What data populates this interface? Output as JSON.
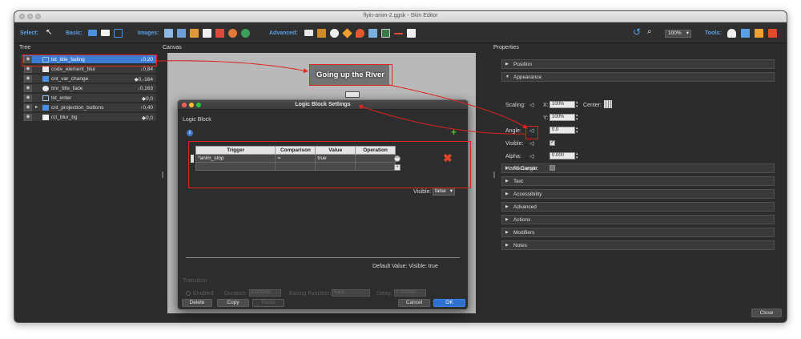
{
  "window": {
    "title": "flyin-anim-2.ggsk - Skin Editor"
  },
  "toolbar": {
    "select_label": "Select:",
    "basic_label": "Basic:",
    "images_label": "Images:",
    "advanced_label": "Advanced:",
    "zoom_value": "100%",
    "tools_label": "Tools:"
  },
  "panels": {
    "tree_label": "Tree",
    "canvas_label": "Canvas",
    "properties_label": "Properties"
  },
  "tree": {
    "items": [
      {
        "name": "txt_title_fading",
        "value": "↓0,20",
        "icon": "text-icon",
        "selected": true
      },
      {
        "name": "code_element_blur",
        "value": "↓0,84",
        "icon": "code-icon",
        "selected": false
      },
      {
        "name": "cnt_var_change",
        "value": "◆0,-164",
        "icon": "folder-icon",
        "selected": false
      },
      {
        "name": "tmr_title_fade",
        "value": "↓0,163",
        "icon": "timer-icon",
        "selected": false
      },
      {
        "name": "txt_enter",
        "value": "◆0,0",
        "icon": "text-icon",
        "selected": false
      },
      {
        "name": "cnt_projection_buttons",
        "value": "↑0,40",
        "icon": "folder-icon",
        "selected": false
      },
      {
        "name": "rct_blur_bg",
        "value": "◆0,0",
        "icon": "rectangle-icon",
        "selected": false
      }
    ]
  },
  "canvas": {
    "title_text": "Going up the River"
  },
  "properties": {
    "sections": [
      {
        "label": "Position",
        "expanded": false
      },
      {
        "label": "Appearance",
        "expanded": true
      },
      {
        "label": "Rectangle",
        "expanded": false
      },
      {
        "label": "Text",
        "expanded": false
      },
      {
        "label": "Accessibility",
        "expanded": false
      },
      {
        "label": "Advanced",
        "expanded": false
      },
      {
        "label": "Actions",
        "expanded": false
      },
      {
        "label": "Modifiers",
        "expanded": false
      },
      {
        "label": "Notes",
        "expanded": false
      }
    ],
    "scaling_label": "Scaling:",
    "x_label": "X:",
    "scale_x": "100%",
    "center_label": "Center:",
    "y_label": "Y:",
    "scale_y": "100%",
    "angle_label": "Angle:",
    "angle_value": "0.0",
    "visible_label": "Visible:",
    "alpha_label": "Alpha:",
    "alpha_value": "0.000",
    "hand_cursor_label": "Hand Cursor:"
  },
  "dialog": {
    "title": "Logic Block Settings",
    "section_label": "Logic Block",
    "columns": [
      "Trigger",
      "Comparison",
      "Value",
      "Operation"
    ],
    "rows": [
      [
        "*anim_stop",
        "=",
        "true",
        ""
      ],
      [
        "",
        "",
        "",
        ""
      ]
    ],
    "visible_label": "Visible:",
    "visible_value": "false",
    "default_value_text": "Default Value:   Visible: true",
    "transition_label": "Transition",
    "enabled_label": "Enabled",
    "duration_label": "Duration:",
    "duration_value": "0.000sec",
    "easing_label": "Easing Function:",
    "easing_value": "Ease",
    "delay_label": "Delay:",
    "delay_value": "0.000sec",
    "delete_label": "Delete",
    "copy_label": "Copy",
    "paste_label": "Paste",
    "cancel_label": "Cancel",
    "ok_label": "OK"
  },
  "close_label": "Close",
  "colors": {
    "accent": "#3b7bd4",
    "annotation_red": "#e0231c",
    "panel_bg": "#2c2c2c"
  }
}
